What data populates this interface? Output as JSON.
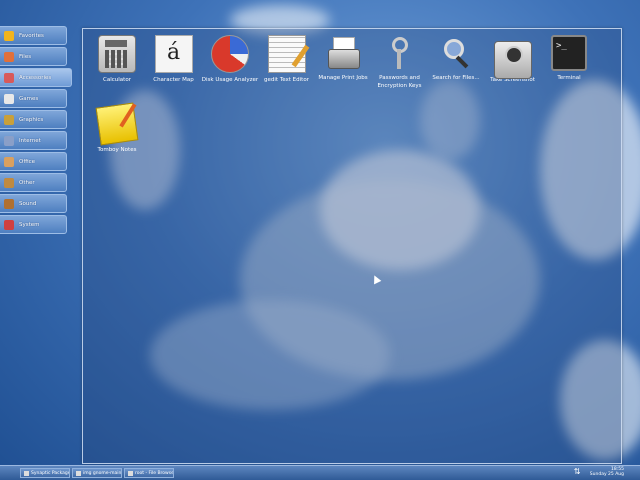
{
  "sidebar": {
    "items": [
      {
        "label": "Favorites",
        "icon": "star-icon",
        "color": "#f2b41d"
      },
      {
        "label": "Files",
        "icon": "folder-icon",
        "color": "#e0703a"
      },
      {
        "label": "Accessories",
        "icon": "accessories-icon",
        "color": "#d85a5a"
      },
      {
        "label": "Games",
        "icon": "games-icon",
        "color": "#e8e8e8"
      },
      {
        "label": "Graphics",
        "icon": "graphics-icon",
        "color": "#c9a03a"
      },
      {
        "label": "Internet",
        "icon": "internet-icon",
        "color": "#8a9fc8"
      },
      {
        "label": "Office",
        "icon": "office-icon",
        "color": "#d9a060"
      },
      {
        "label": "Other",
        "icon": "other-icon",
        "color": "#c08a40"
      },
      {
        "label": "Sound",
        "icon": "sound-icon",
        "color": "#b07030"
      },
      {
        "label": "System",
        "icon": "system-icon",
        "color": "#d04040"
      }
    ],
    "active_index": 2
  },
  "apps": [
    {
      "label": "Calculator",
      "icon": "calculator-icon"
    },
    {
      "label": "Character Map",
      "icon": "character-map-icon",
      "glyph": "á"
    },
    {
      "label": "Disk Usage Analyzer",
      "icon": "disk-usage-icon"
    },
    {
      "label": "gedit Text Editor",
      "icon": "text-editor-icon"
    },
    {
      "label": "Manage Print Jobs",
      "icon": "printer-icon"
    },
    {
      "label": "Passwords and Encryption Keys",
      "icon": "keys-icon"
    },
    {
      "label": "Search for Files...",
      "icon": "search-icon"
    },
    {
      "label": "Take Screenshot",
      "icon": "camera-icon"
    },
    {
      "label": "Terminal",
      "icon": "terminal-icon",
      "glyph": ">_"
    },
    {
      "label": "Tomboy Notes",
      "icon": "notes-icon"
    }
  ],
  "taskbar": {
    "tasks": [
      {
        "label": "Synaptic Package Ma..."
      },
      {
        "label": "img gnome-mainmenu..."
      },
      {
        "label": "root - File Browser"
      }
    ],
    "clock_time": "18:55",
    "clock_date": "Sunday 25 Aug"
  }
}
